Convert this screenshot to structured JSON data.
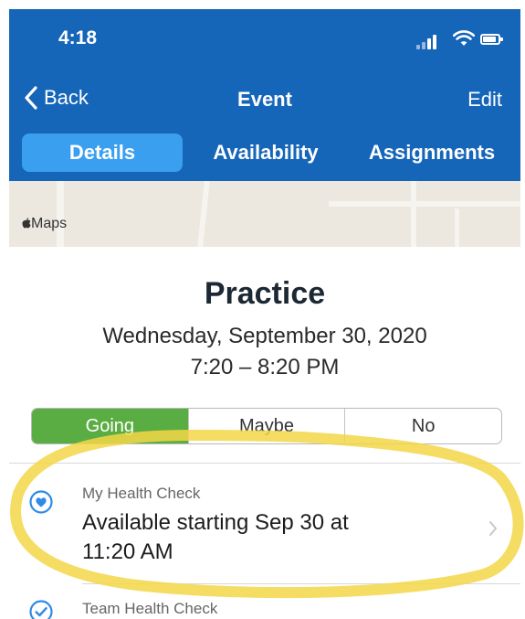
{
  "status_bar": {
    "time": "4:18"
  },
  "nav": {
    "back_label": "Back",
    "title": "Event",
    "edit_label": "Edit"
  },
  "tabs": [
    {
      "label": "Details",
      "active": true
    },
    {
      "label": "Availability",
      "active": false
    },
    {
      "label": "Assignments",
      "active": false
    }
  ],
  "map": {
    "attribution": "Maps"
  },
  "event": {
    "title": "Practice",
    "date": "Wednesday, September 30, 2020",
    "time": "7:20 – 8:20 PM"
  },
  "rsvp": {
    "options": [
      {
        "label": "Going",
        "selected": true
      },
      {
        "label": "Maybe",
        "selected": false
      },
      {
        "label": "No",
        "selected": false
      }
    ]
  },
  "health_check": {
    "label": "My Health Check",
    "value_line1": "Available starting Sep 30 at",
    "value_line2": "11:20 AM"
  },
  "team_health_check": {
    "label": "Team Health Check"
  },
  "colors": {
    "header": "#1565b8",
    "active_tab": "#3a9fee",
    "going_green": "#5aad42",
    "icon_blue": "#2f8be6",
    "highlight_yellow": "#f3d648"
  }
}
